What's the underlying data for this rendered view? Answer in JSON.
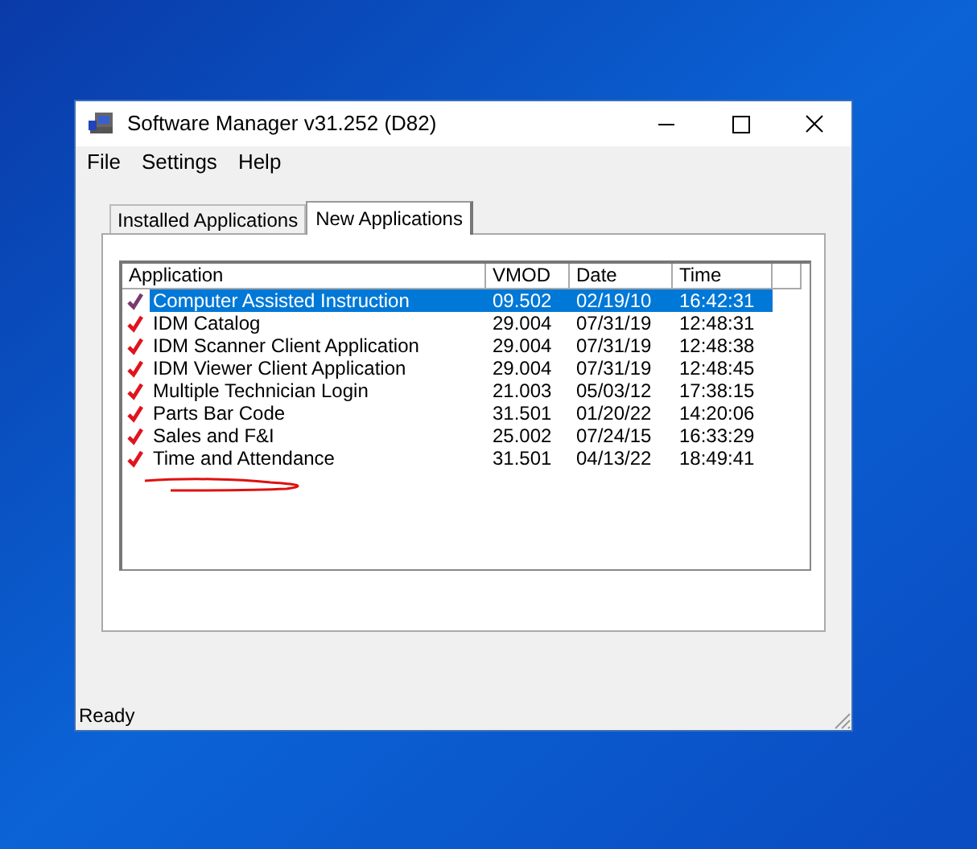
{
  "window": {
    "title": "Software Manager v31.252 (D82)"
  },
  "menu": [
    "File",
    "Settings",
    "Help"
  ],
  "tabs": [
    {
      "label": "Installed Applications",
      "selected": false
    },
    {
      "label": "New Applications",
      "selected": true
    }
  ],
  "table": {
    "columns": [
      "Application",
      "VMOD",
      "Date",
      "Time"
    ],
    "rows": [
      {
        "cells": [
          "Computer Assisted Instruction",
          "09.502",
          "02/19/10",
          "16:42:31"
        ],
        "selected": true
      },
      {
        "cells": [
          "IDM Catalog",
          "29.004",
          "07/31/19",
          "12:48:31"
        ],
        "selected": false
      },
      {
        "cells": [
          "IDM Scanner Client Application",
          "29.004",
          "07/31/19",
          "12:48:38"
        ],
        "selected": false
      },
      {
        "cells": [
          "IDM Viewer Client Application",
          "29.004",
          "07/31/19",
          "12:48:45"
        ],
        "selected": false
      },
      {
        "cells": [
          "Multiple Technician Login",
          "21.003",
          "05/03/12",
          "17:38:15"
        ],
        "selected": false
      },
      {
        "cells": [
          "Parts Bar Code",
          "31.501",
          "01/20/22",
          "14:20:06"
        ],
        "selected": false
      },
      {
        "cells": [
          "Sales and F&I",
          "25.002",
          "07/24/15",
          "16:33:29"
        ],
        "selected": false
      },
      {
        "cells": [
          "Time and Attendance",
          "31.501",
          "04/13/22",
          "18:49:41"
        ],
        "selected": false
      }
    ]
  },
  "status_bar": "Ready"
}
